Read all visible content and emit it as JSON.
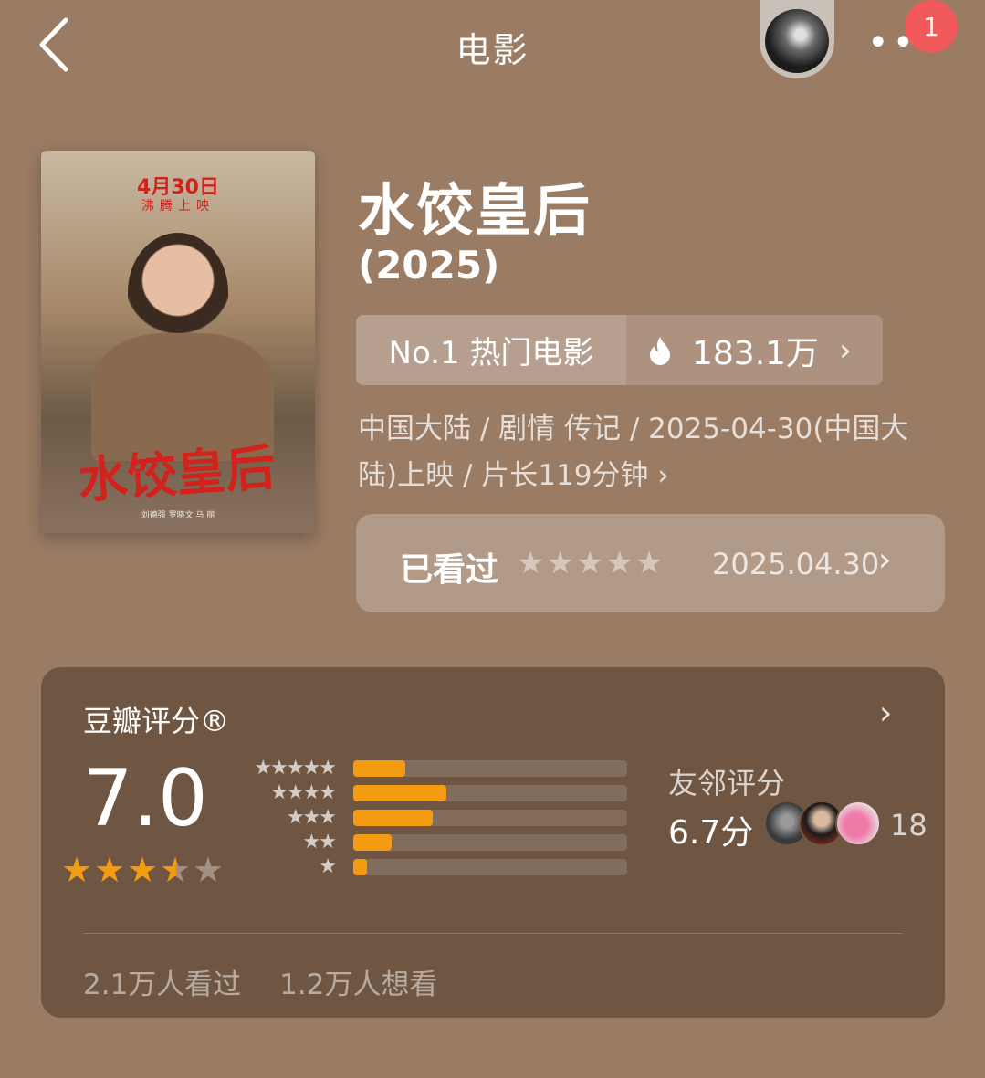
{
  "header": {
    "title": "电影",
    "notification_count": "1",
    "more_icon": "ellipsis-icon",
    "back_icon": "chevron-left-icon"
  },
  "poster": {
    "release_date_text": "4月30日",
    "release_sub_text": "沸腾上映",
    "title_art_text": "水饺皇后",
    "credits_text": "刘德强   罗晓文   马 丽"
  },
  "movie": {
    "title": "水饺皇后",
    "year": "(2025)",
    "rank_label": "No.1 热门电影",
    "heat_value": "183.1万",
    "meta_text": "中国大陆 / 剧情 传记 / 2025-04-30(中国大陆)上映 / 片长119分钟 ›"
  },
  "seen": {
    "label": "已看过",
    "stars": "★★★★★",
    "date": "2025.04.30"
  },
  "rating": {
    "label": "豆瓣评分®",
    "score": "7.0",
    "star_value": 3.5,
    "distribution": [
      {
        "stars": "★★★★★",
        "fraction": 0.19
      },
      {
        "stars": "★★★★",
        "fraction": 0.34
      },
      {
        "stars": "★★★",
        "fraction": 0.29
      },
      {
        "stars": "★★",
        "fraction": 0.14
      },
      {
        "stars": "★",
        "fraction": 0.05
      }
    ],
    "friends_label": "友邻评分",
    "friends_score": "6.7分",
    "friends_count": "18",
    "watched": "2.1万人看过",
    "wish": "1.2万人想看"
  },
  "colors": {
    "background": "#9a7b63",
    "card": "#6e5643",
    "accent_star": "#f39c12",
    "badge": "#f05a5a"
  }
}
